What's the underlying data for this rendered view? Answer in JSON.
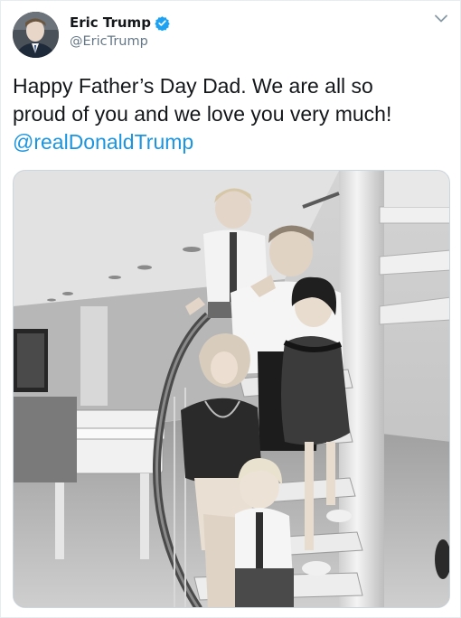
{
  "tweet": {
    "author": {
      "display_name": "Eric Trump",
      "handle": "@EricTrump",
      "verified": true,
      "avatar_icon": "profile-photo"
    },
    "text_lines": [
      "Happy Father’s Day Dad. We are all so",
      "proud of you and we love you very much!"
    ],
    "mention": "@realDonaldTrump",
    "media": {
      "type": "black-and-white-photo",
      "content": "family posing on spiral staircase"
    }
  },
  "icons": {
    "verified": "verified-badge-icon",
    "caret": "chevron-down-icon"
  },
  "colors": {
    "link": "#1b95e0",
    "verified_badge": "#1da1f2",
    "secondary_text": "#657786",
    "primary_text": "#14171a"
  }
}
